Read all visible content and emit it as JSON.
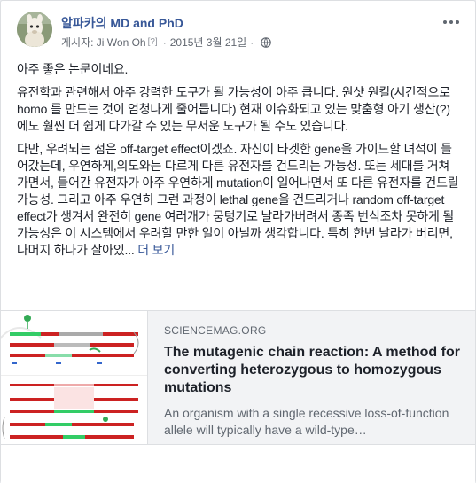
{
  "post": {
    "page_name": "알파카의 MD and PhD",
    "meta": {
      "posted_by": "게시자: Ji Won Oh",
      "help_marker": "[?]",
      "separator": "·",
      "date": "2015년 3월 21일",
      "privacy_icon": "globe-icon"
    },
    "more_icon": "more-icon",
    "paragraphs": [
      "아주 좋은 논문이네요.",
      "유전학과 관련해서 아주 강력한 도구가 될 가능성이 아주 큽니다. 원샷 원킬(시간적으로 homo 를 만드는 것이 엄청나게 줄어듭니다) 현재 이슈화되고 있는 맞춤형 아기 생산(?)에도 훨씬 더 쉽게 다가갈 수 있는 무서운 도구가 될 수도 있습니다.",
      "다만, 우려되는 점은 off-target effect이겠죠. 자신이 타겟한 gene을 가이드할 녀석이 들어갔는데, 우연하게,의도와는 다르게 다른 유전자를 건드리는 가능성. 또는 세대를 거쳐가면서, 들어간 유전자가 아주 우연하게 mutation이 일어나면서 또 다른 유전자를 건드릴 가능성. 그리고 아주 우연히 그런 과정이 lethal gene을 건드리거나 random off-target effect가 생겨서 완전히 gene 여러개가 뭉텅기로 날라가버려서 종족 번식조차 못하게 될 가능성은 이 시스템에서 우려할 만한 일이 아닐까 생각합니다. 특히 한번 날라가 버리면, 나머지 하나가 살아있..."
    ],
    "see_more": "더 보기"
  },
  "link_preview": {
    "domain": "SCIENCEMAG.ORG",
    "title": "The mutagenic chain reaction: A method for converting heterozygous to homozygous mutations",
    "description": "An organism with a single recessive loss-of-function allele will typically have a wild-type…"
  },
  "colors": {
    "link_blue": "#385898",
    "text": "#1d2129",
    "muted": "#616770",
    "card_bg": "#f2f3f5"
  }
}
